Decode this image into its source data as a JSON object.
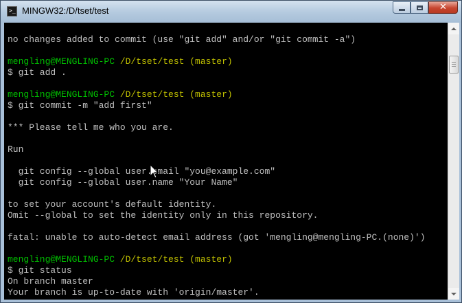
{
  "window": {
    "title": "MINGW32:/D/tset/test",
    "app_icon_glyph": ">_",
    "controls": {
      "close_glyph": "✕"
    }
  },
  "terminal": {
    "colors": {
      "background": "#000000",
      "text": "#c0c0c0",
      "user_host": "#00c000",
      "path": "#c0c000"
    },
    "lines": [
      {
        "text": "no changes added to commit (use \"git add\" and/or \"git commit -a\")"
      },
      {
        "text": ""
      },
      {
        "user": "mengling@MENGLING-PC",
        "path": "/D/tset/test (master)"
      },
      {
        "text": "$ git add ."
      },
      {
        "text": ""
      },
      {
        "user": "mengling@MENGLING-PC",
        "path": "/D/tset/test (master)"
      },
      {
        "text": "$ git commit -m \"add first\""
      },
      {
        "text": ""
      },
      {
        "text": "*** Please tell me who you are."
      },
      {
        "text": ""
      },
      {
        "text": "Run"
      },
      {
        "text": ""
      },
      {
        "text": "  git config --global user.email \"you@example.com\""
      },
      {
        "text": "  git config --global user.name \"Your Name\""
      },
      {
        "text": ""
      },
      {
        "text": "to set your account's default identity."
      },
      {
        "text": "Omit --global to set the identity only in this repository."
      },
      {
        "text": ""
      },
      {
        "text": "fatal: unable to auto-detect email address (got 'mengling@mengling-PC.(none)')"
      },
      {
        "text": ""
      },
      {
        "user": "mengling@MENGLING-PC",
        "path": "/D/tset/test (master)"
      },
      {
        "text": "$ git status"
      },
      {
        "text": "On branch master"
      },
      {
        "text": "Your branch is up-to-date with 'origin/master'."
      }
    ]
  }
}
